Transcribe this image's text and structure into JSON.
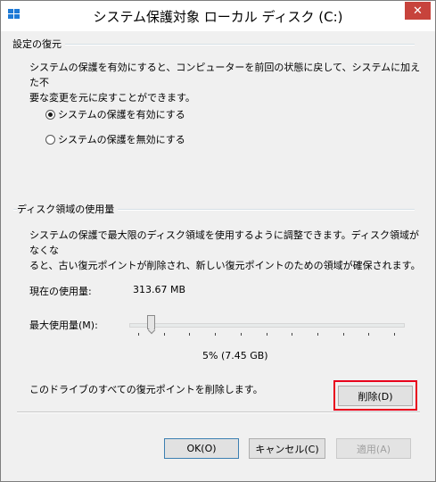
{
  "window": {
    "title": "システム保護対象 ローカル ディスク (C:)",
    "close_glyph": "✕",
    "accent_close": "#c7433c"
  },
  "restore_settings": {
    "group_label": "設定の復元",
    "description_line1": "システムの保護を有効にすると、コンピューターを前回の状態に戻して、システムに加えた不",
    "description_line2": "要な変更を元に戻すことができます。",
    "enable_label": "システムの保護を有効にする",
    "disable_label": "システムの保護を無効にする",
    "selected": "enable"
  },
  "disk_usage": {
    "group_label": "ディスク領域の使用量",
    "description_line1": "システムの保護で最大限のディスク領域を使用するように調整できます。ディスク領域がなくな",
    "description_line2": "ると、古い復元ポイントが削除され、新しい復元ポイントのための領域が確保されます。",
    "current_usage_label": "現在の使用量:",
    "current_usage_value": "313.67 MB",
    "max_usage_label": "最大使用量(M):",
    "max_usage_fraction": 0.05,
    "max_usage_value": "5% (7.45 GB)",
    "delete_description": "このドライブのすべての復元ポイントを削除します。",
    "delete_button": "削除(D)"
  },
  "footer": {
    "ok_button": "OK(O)",
    "cancel_button": "キャンセル(C)",
    "apply_button": "適用(A)"
  },
  "highlight_color": "#e8001c"
}
